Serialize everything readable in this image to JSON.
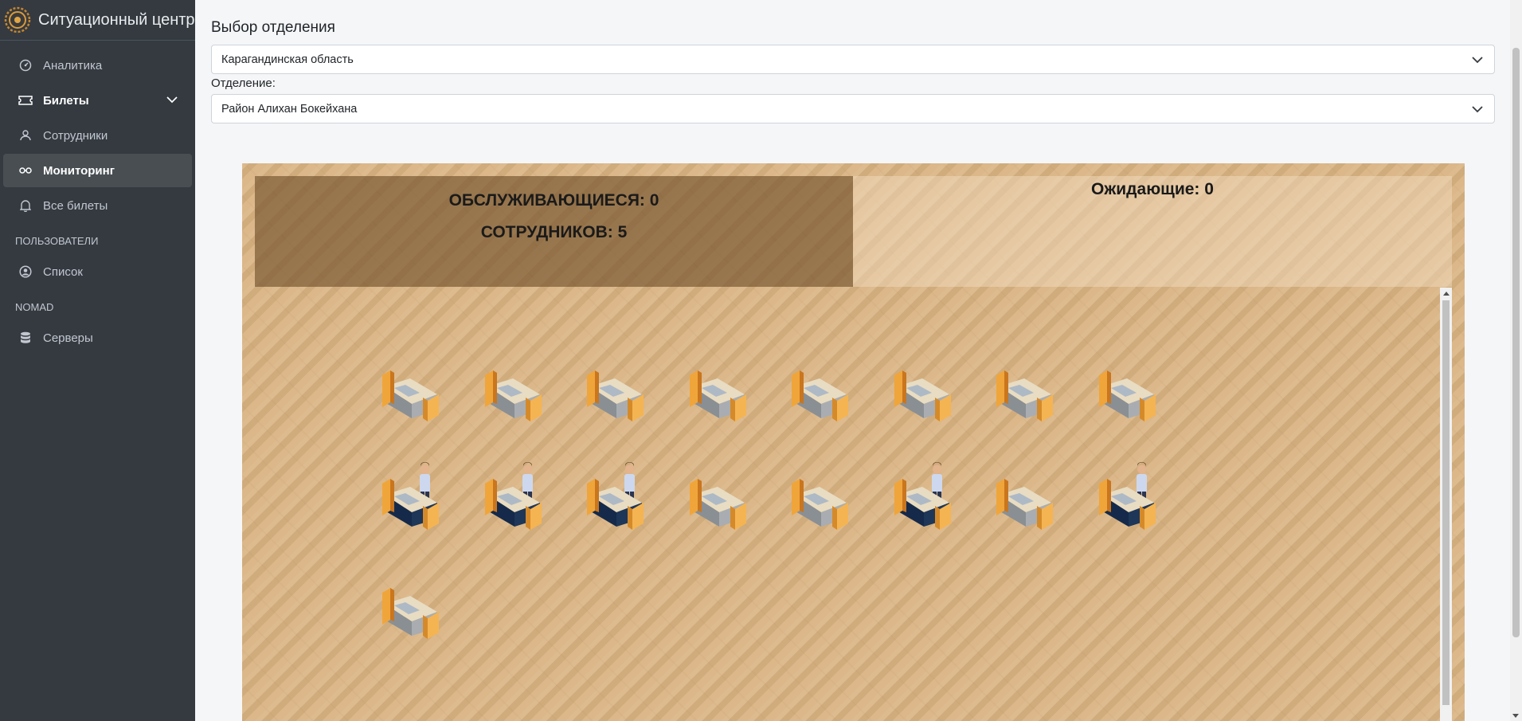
{
  "app": {
    "title": "Ситуационный центр"
  },
  "sidebar": {
    "items": [
      {
        "label": "Аналитика",
        "icon": "gauge-icon"
      },
      {
        "label": "Билеты",
        "icon": "ticket-icon"
      },
      {
        "label": "Сотрудники",
        "icon": "user-icon"
      },
      {
        "label": "Мониторинг",
        "icon": "glasses-icon"
      },
      {
        "label": "Все билеты",
        "icon": "bell-icon"
      }
    ],
    "section_users": "ПОЛЬЗОВАТЕЛИ",
    "users_items": [
      {
        "label": "Список",
        "icon": "user-circle-icon"
      }
    ],
    "section_nomad": "NOMAD",
    "nomad_items": [
      {
        "label": "Серверы",
        "icon": "database-icon"
      }
    ]
  },
  "main": {
    "select_title": "Выбор отделения",
    "region_value": "Карагандинская область",
    "branch_label": "Отделение:",
    "branch_value": "Район Алихан Бокейхана"
  },
  "hall": {
    "serving_text": "ОБСЛУЖИВАЮЩИЕСЯ: 0",
    "employees_text": "СОТРУДНИКОВ: 5",
    "waiting_text": "Ожидающие: 0",
    "desk_rows": [
      [
        false,
        false,
        false,
        false,
        false,
        false,
        false,
        false
      ],
      [
        true,
        true,
        true,
        false,
        false,
        true,
        false,
        true
      ],
      [
        false
      ]
    ]
  },
  "colors": {
    "sidebar_bg": "#343a40",
    "sidebar_active": "#494e53",
    "floor": "#d9b382",
    "desk_orange": "#f0a53a"
  }
}
